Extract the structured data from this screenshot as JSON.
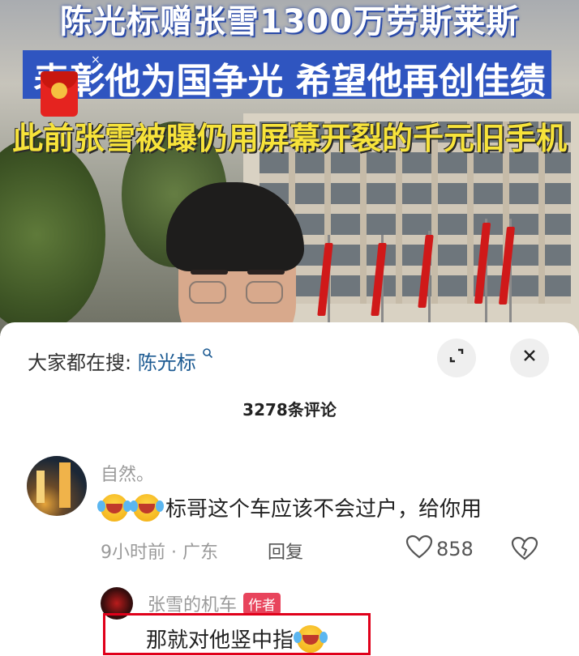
{
  "video": {
    "banner_line1": "陈光标赠张雪1300万劳斯莱斯",
    "banner_line2": "表彰他为国争光 希望他再创佳绩",
    "banner_line3": "此前张雪被曝仍用屏幕开裂的千元旧手机",
    "red_packet_close": "×"
  },
  "panel": {
    "search_prefix": "大家都在搜:",
    "search_term": "陈光标",
    "search_icon": "search-icon",
    "expand_icon": "expand-icon",
    "close_icon": "close-icon",
    "comment_count": "3278条评论"
  },
  "comment": {
    "username": "自然。",
    "text": "标哥这个车应该不会过户，给你用",
    "time_location": "9小时前 · 广东",
    "reply_label": "回复",
    "likes": "858"
  },
  "reply": {
    "username": "张雪的机车",
    "author_tag": "作者",
    "text": "那就对他竖中指"
  }
}
